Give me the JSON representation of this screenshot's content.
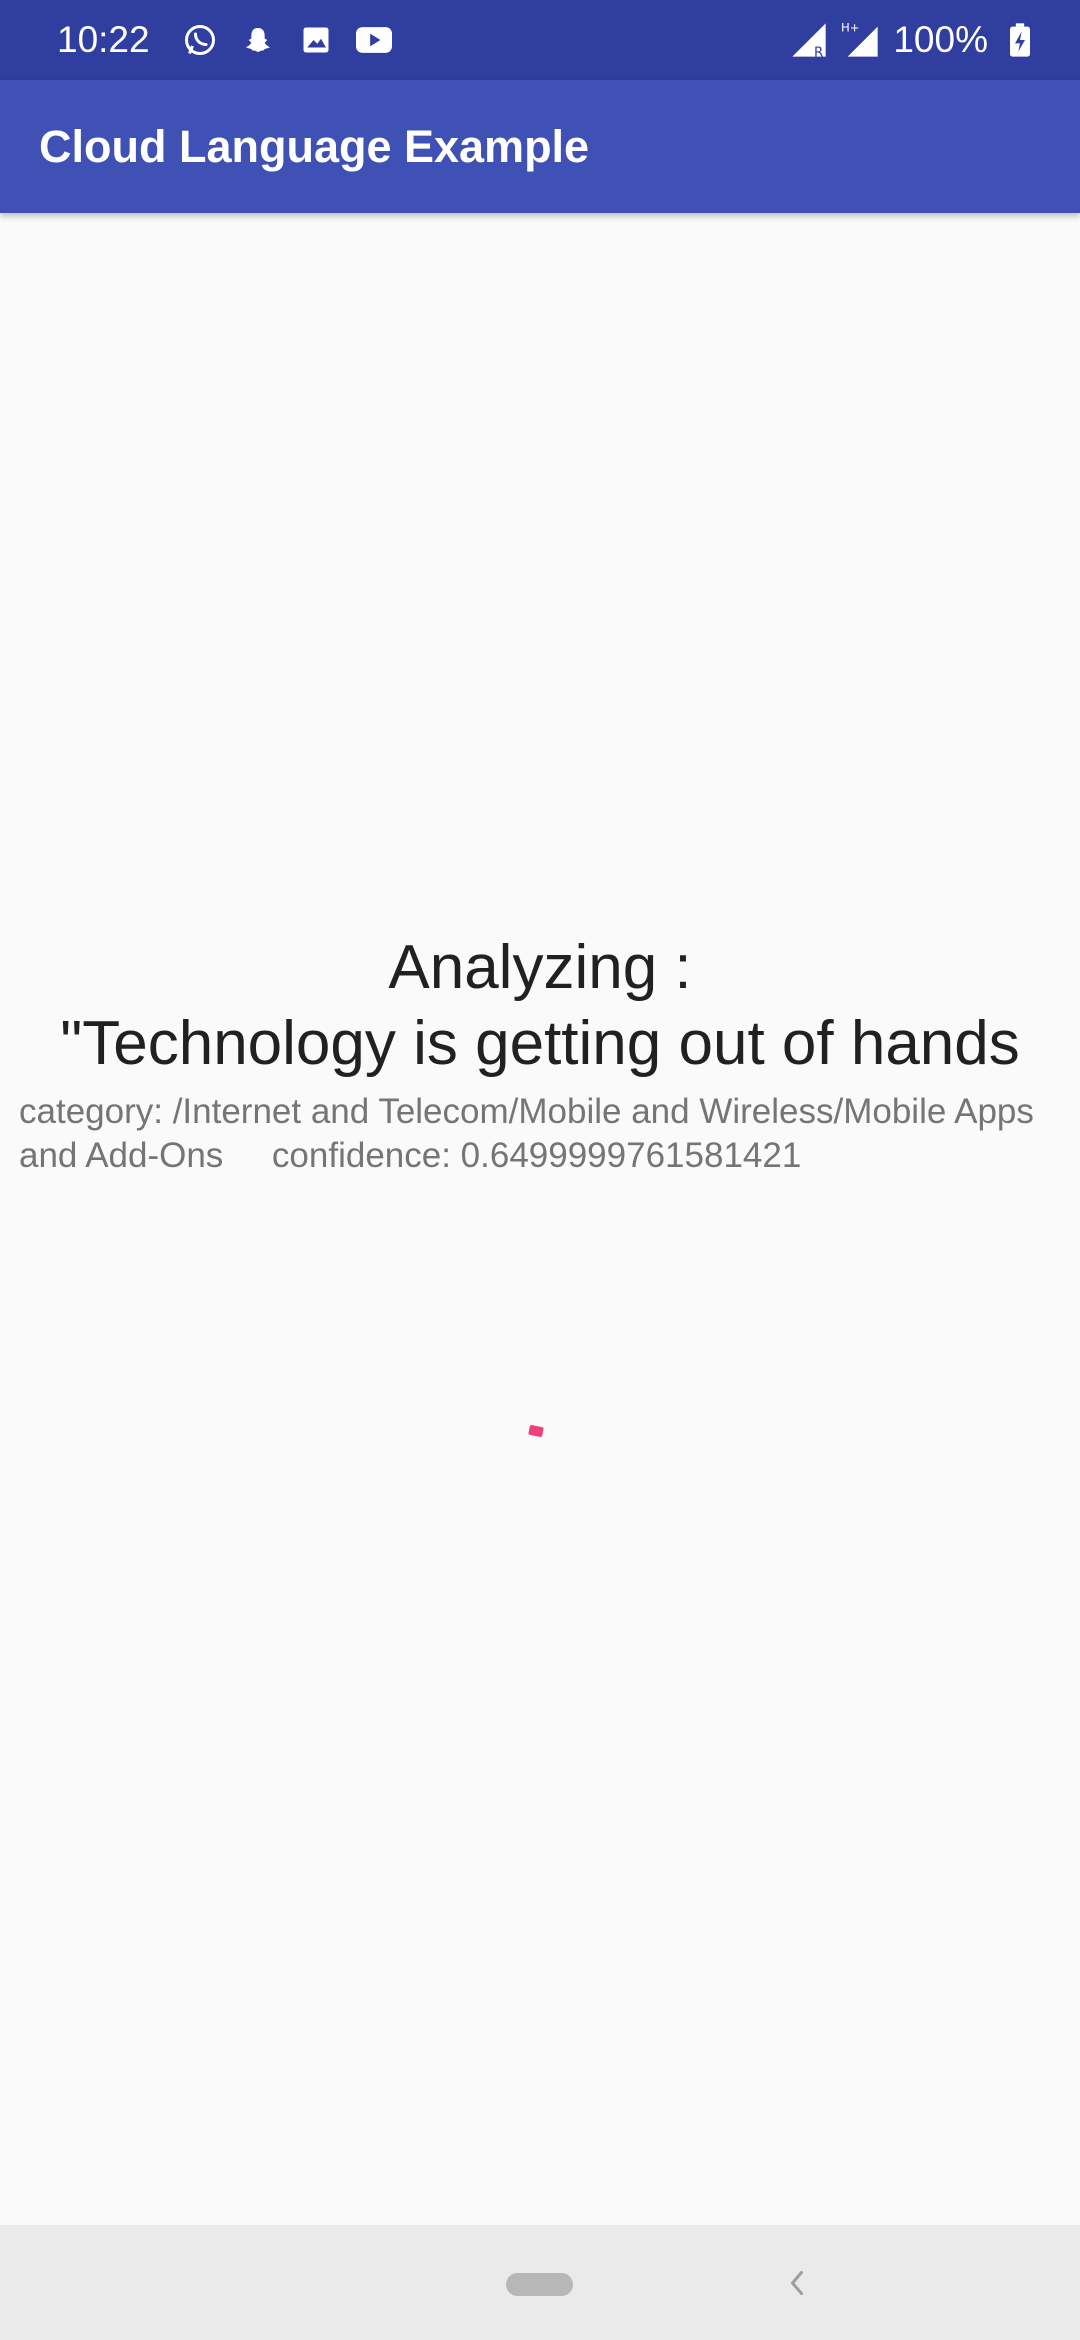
{
  "status_bar": {
    "time": "10:22",
    "icons": [
      "whatsapp-icon",
      "snapchat-icon",
      "gallery-icon",
      "youtube-icon"
    ],
    "battery": "100%"
  },
  "app_bar": {
    "title": "Cloud Language Example"
  },
  "main": {
    "heading": "Analyzing :",
    "analyzed_text": "\"Technology is getting out of hands",
    "result": "category: /Internet and Telecom/Mobile and Wireless/Mobile Apps and Add-Ons     confidence: 0.6499999761581421"
  },
  "colors": {
    "status_bar": "#303f9f",
    "app_bar": "#3f51b5",
    "accent": "#ec407a",
    "background": "#fafafa"
  }
}
